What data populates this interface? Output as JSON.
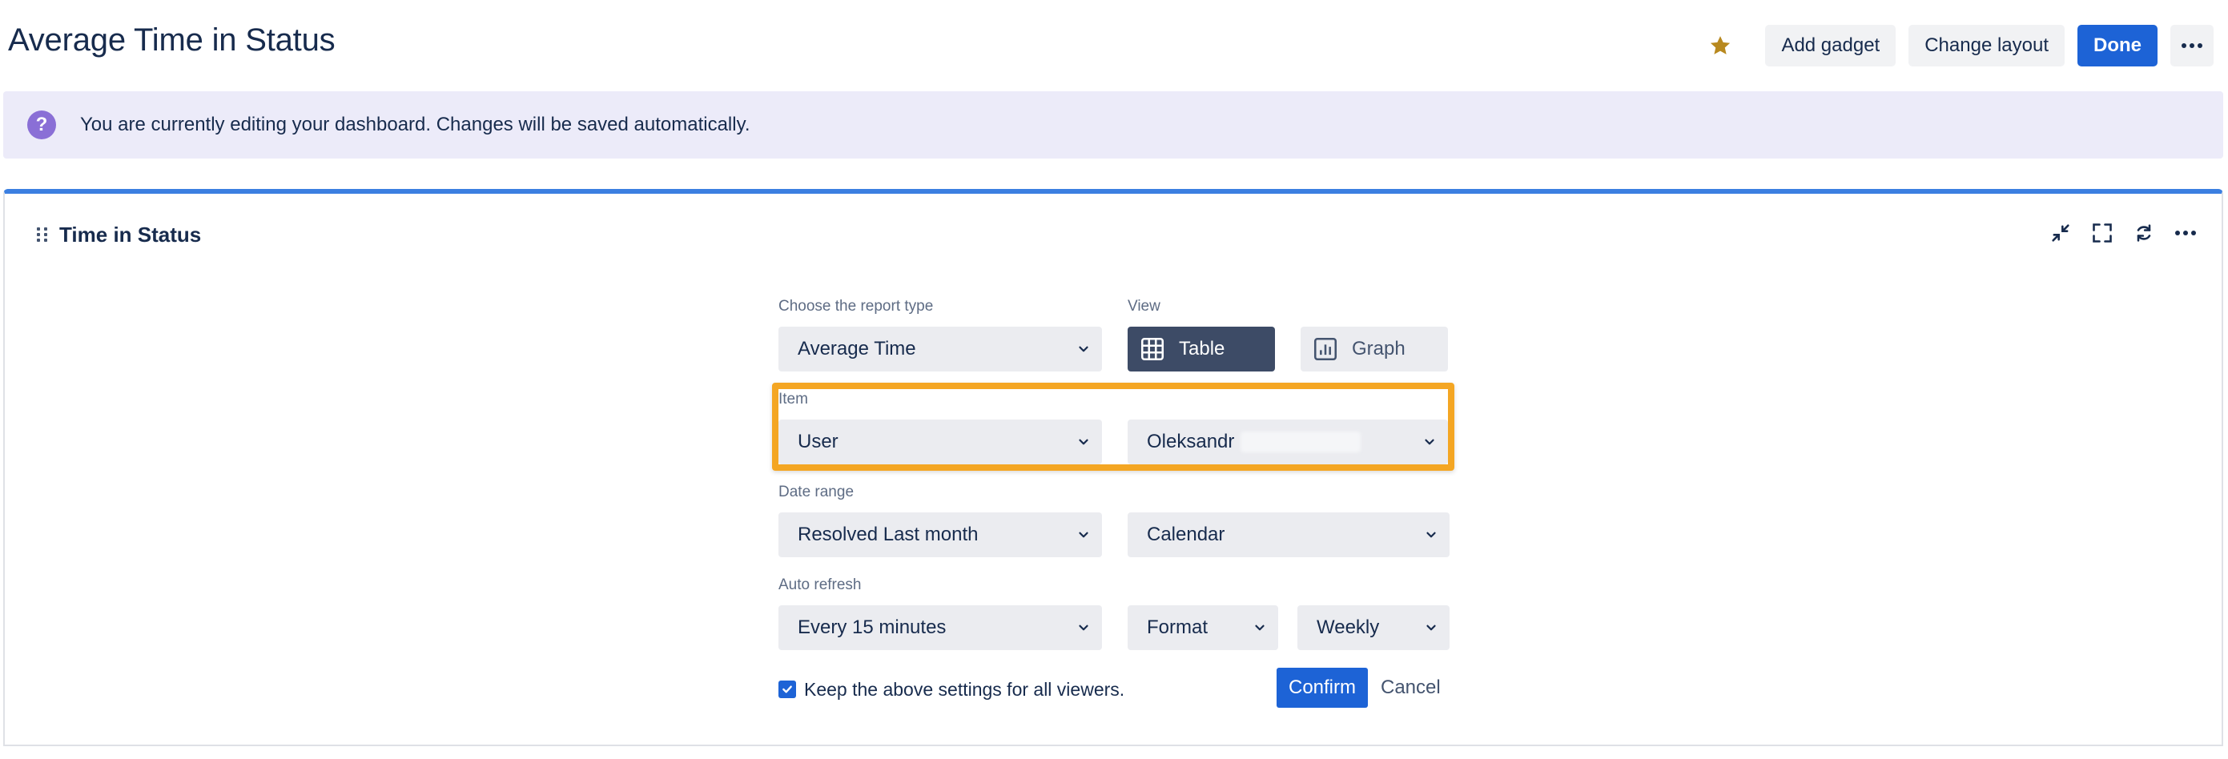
{
  "page": {
    "title": "Average Time in Status"
  },
  "header": {
    "star_icon": "star-icon",
    "add_gadget_label": "Add gadget",
    "change_layout_label": "Change layout",
    "done_label": "Done",
    "more_icon": "more-horizontal-icon"
  },
  "banner": {
    "icon": "question-circle-icon",
    "message": "You are currently editing your dashboard. Changes will be saved automatically."
  },
  "gadget": {
    "title": "Time in Status",
    "tools": [
      "minimize-icon",
      "fullscreen-icon",
      "refresh-icon",
      "more-horizontal-icon"
    ],
    "report_type": {
      "label": "Choose the report type",
      "value": "Average Time"
    },
    "view": {
      "label": "View",
      "table_label": "Table",
      "graph_label": "Graph",
      "selected": "Table"
    },
    "item": {
      "label": "Item",
      "type_value": "User",
      "user_value": "Oleksandr"
    },
    "date_range": {
      "label": "Date range",
      "value": "Resolved Last month",
      "calendar_value": "Calendar"
    },
    "auto_refresh": {
      "label": "Auto refresh",
      "value": "Every 15 minutes",
      "format_value": "Format",
      "period_value": "Weekly"
    },
    "keep_settings": {
      "checked": true,
      "label": "Keep the above settings for all viewers."
    },
    "confirm_label": "Confirm",
    "cancel_label": "Cancel"
  },
  "colors": {
    "accent": "#1d63d6",
    "banner_bg": "#ecebf9",
    "highlight": "#f4a623",
    "view_active": "#3d4b66",
    "star": "#b8891f"
  }
}
